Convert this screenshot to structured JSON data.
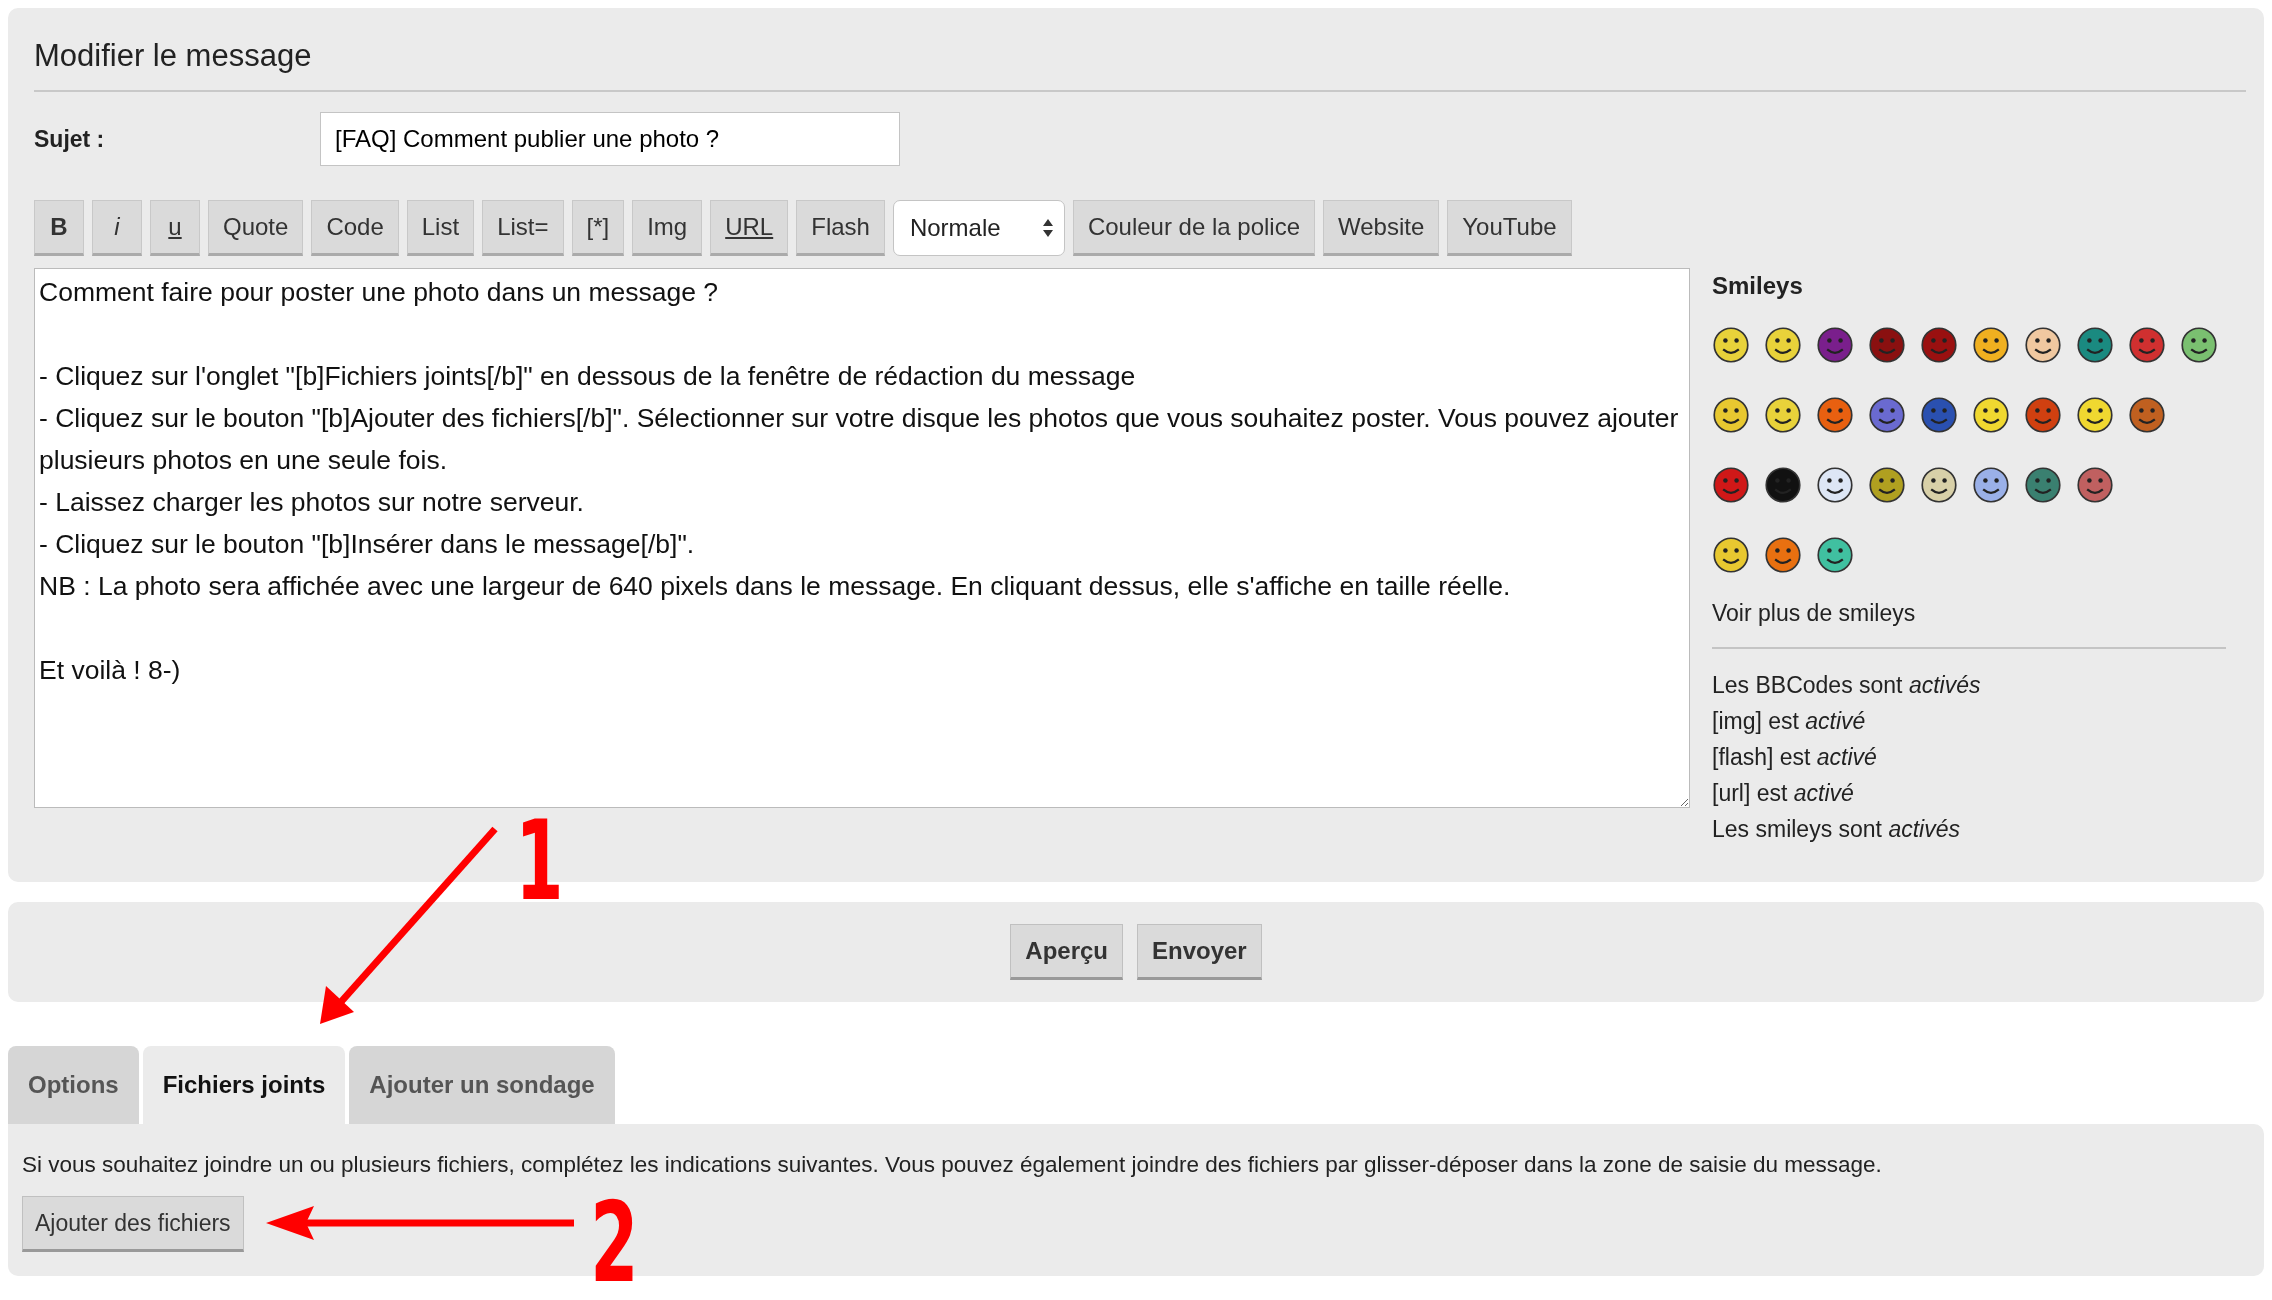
{
  "title": "Modifier le message",
  "subject": {
    "label": "Sujet :",
    "value": "[FAQ] Comment publier une photo ?"
  },
  "toolbar": [
    {
      "kind": "bold",
      "label": "B"
    },
    {
      "kind": "italic",
      "label": "i"
    },
    {
      "kind": "underline",
      "label": "u"
    },
    {
      "kind": "button",
      "label": "Quote"
    },
    {
      "kind": "button",
      "label": "Code"
    },
    {
      "kind": "button",
      "label": "List"
    },
    {
      "kind": "button",
      "label": "List="
    },
    {
      "kind": "button",
      "label": "[*]"
    },
    {
      "kind": "button",
      "label": "Img"
    },
    {
      "kind": "underline",
      "label": "URL"
    },
    {
      "kind": "button",
      "label": "Flash"
    },
    {
      "kind": "select",
      "label": "Normale"
    },
    {
      "kind": "button",
      "label": "Couleur de la police"
    },
    {
      "kind": "button",
      "label": "Website"
    },
    {
      "kind": "button",
      "label": "YouTube"
    }
  ],
  "message": {
    "value": "Comment faire pour poster une photo dans un message ?\n\n- Cliquez sur l'onglet \"[b]Fichiers joints[/b]\" en dessous de la fenêtre de rédaction du message\n- Cliquez sur le bouton \"[b]Ajouter des fichiers[/b]\". Sélectionner sur votre disque les photos que vous souhaitez poster. Vous pouvez ajouter plusieurs photos en une seule fois.\n- Laissez charger les photos sur notre serveur.\n- Cliquez sur le bouton \"[b]Insérer dans le message[/b]\".\nNB : La photo sera affichée avec une largeur de 640 pixels dans le message. En cliquant dessus, elle s'affiche en taille réelle.\n\nEt voilà ! 8-)"
  },
  "smileys": {
    "title": "Smileys",
    "rows": [
      [
        {
          "color": "#e8d23a"
        },
        {
          "color": "#e8d23a"
        },
        {
          "color": "#7a1f8c"
        },
        {
          "color": "#8a1010"
        },
        {
          "color": "#9a1010"
        },
        {
          "color": "#f0b020"
        },
        {
          "color": "#f0c8a0"
        },
        {
          "color": "#1a8a80"
        },
        {
          "color": "#d03030"
        },
        {
          "color": "#7ac070"
        }
      ],
      [
        {
          "color": "#e8c830"
        },
        {
          "color": "#e8d23a"
        },
        {
          "color": "#e86010"
        },
        {
          "color": "#6a6ad0"
        },
        {
          "color": "#2a50b0"
        },
        {
          "color": "#f0d830"
        },
        {
          "color": "#d04010"
        },
        {
          "color": "#f0d830"
        },
        {
          "color": "#c06020"
        }
      ],
      [
        {
          "color": "#d01818"
        },
        {
          "color": "#111111"
        },
        {
          "color": "#dde6f5"
        },
        {
          "color": "#b0a020"
        },
        {
          "color": "#d8d0a8"
        },
        {
          "color": "#9ab0e8"
        },
        {
          "color": "#3a8070"
        },
        {
          "color": "#c06060"
        }
      ],
      [
        {
          "color": "#e8c830"
        },
        {
          "color": "#e87010"
        },
        {
          "color": "#40c0a0"
        }
      ]
    ],
    "more": "Voir plus de smileys"
  },
  "status": [
    "Les BBCodes sont *activés*",
    "[img] est *activé*",
    "[flash] est *activé*",
    "[url] est *activé*",
    "Les smileys sont *activés*"
  ],
  "actions": [
    "Aperçu",
    "Envoyer"
  ],
  "tabs": [
    {
      "label": "Options",
      "selected": false
    },
    {
      "label": "Fichiers joints",
      "selected": true
    },
    {
      "label": "Ajouter un sondage",
      "selected": false
    }
  ],
  "attachments": {
    "text": "Si vous souhaitez joindre un ou plusieurs fichiers, complétez les indications suivantes. Vous pouvez également joindre des fichiers par glisser-déposer dans la zone de saisie du message.",
    "button": "Ajouter des fichiers"
  },
  "annotations": [
    {
      "number": "1"
    },
    {
      "number": "2"
    }
  ]
}
